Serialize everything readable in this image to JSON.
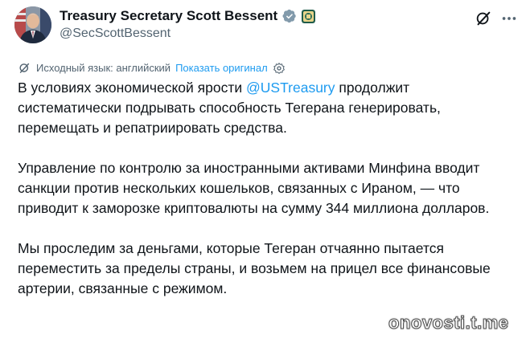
{
  "author": {
    "display_name": "Treasury Secretary Scott Bessent",
    "handle": "@SecScottBessent",
    "verified": true,
    "avatar_icon": "profile-photo"
  },
  "actions": {
    "grok_icon": "grok-icon",
    "more_icon": "more-horizontal-icon"
  },
  "translation": {
    "source_language_label": "Исходный язык: английский",
    "show_original_label": "Показать оригинал"
  },
  "tweet": {
    "p1_before": "В условиях экономической ярости ",
    "p1_mention": "@USTreasury",
    "p1_after": " продолжит систематически подрывать способность Тегерана генерировать, перемещать и репатриировать средства.",
    "p2": "Управление по контролю за иностранными активами Минфина вводит санкции против нескольких кошельков, связанных с Ираном, — что приводит к заморозке криптовалюты на сумму 344 миллиона долларов.",
    "p3": "Мы проследим за деньгами, которые Тегеран отчаянно пытается переместить за пределы страны, и возьмем на прицел все финансовые артерии, связанные с режимом."
  },
  "watermark": "onovosti.t.me",
  "colors": {
    "link": "#1d9bf0",
    "text": "#0f1419",
    "secondary": "#536471",
    "verified": "#1d9bf0"
  }
}
